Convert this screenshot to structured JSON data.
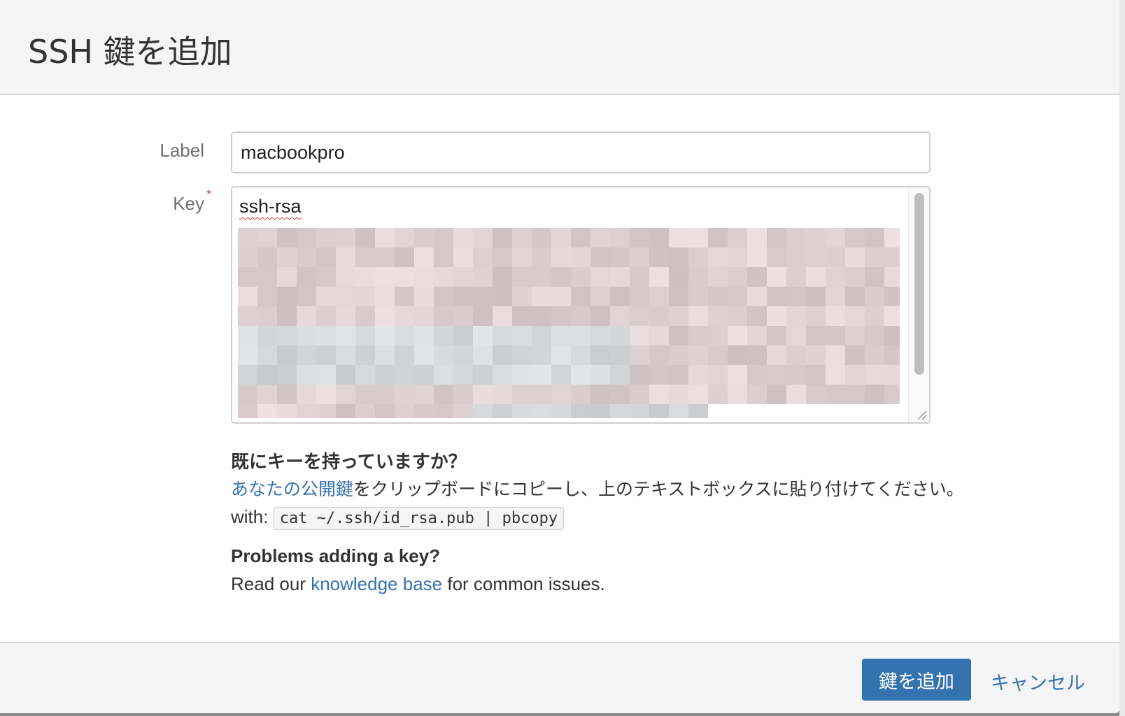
{
  "dialog": {
    "title": "SSH 鍵を追加"
  },
  "form": {
    "label_field": {
      "label": "Label",
      "value": "macbookpro"
    },
    "key_field": {
      "label": "Key",
      "required_mark": "*",
      "visible_text": "ssh-rsa",
      "redacted": true
    }
  },
  "help": {
    "heading": "既にキーを持っていますか？",
    "link_text": "あなたの公開鍵",
    "instruction": "をクリップボードにコピーし、上のテキストボックスに貼り付けてください。",
    "with_label": "with:",
    "command": "cat ~/.ssh/id_rsa.pub | pbcopy",
    "problems_heading": "Problems adding a key?",
    "read_our": "Read our",
    "kb_link": "knowledge base",
    "kb_suffix": "for common issues."
  },
  "footer": {
    "submit_label": "鍵を追加",
    "cancel_label": "キャンセル"
  },
  "colors": {
    "primary": "#3572b0",
    "link": "#3572b0",
    "required": "#d04437"
  }
}
